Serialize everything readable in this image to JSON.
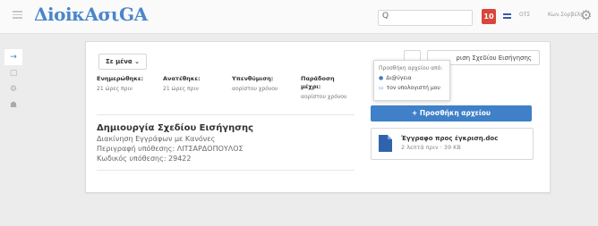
{
  "header": {
    "logo_text": "ΔiοiκΑσιGΑ",
    "search_placeholder": "",
    "notifications_count": "10",
    "ots_label": "ΟΤΣ",
    "user_label": "Κων.Σορβέλη"
  },
  "sidebar": {
    "items": [
      "→",
      "▢",
      "⚙",
      "☗"
    ]
  },
  "card": {
    "dropdown_label": "Σε μένα ⌄",
    "meta": [
      {
        "label": "Ενημερώθηκε:",
        "value": "21 ώρες πριν"
      },
      {
        "label": "Ανατέθηκε:",
        "value": "21 ώρες πριν"
      },
      {
        "label": "Υπενθύμιση:",
        "value": "αορίστου χρόνου"
      },
      {
        "label": "Παράδοση μέχρι:",
        "value": "αορίστου χρόνου"
      }
    ],
    "task_title": "Δημιουργία Σχεδίου Εισήγησης",
    "task_lines": [
      "Διακίνηση Εγγράφων με Κανόνες",
      "Περιγραφή υπόθεσης: ΛΙΤΣΑΡΔΟΠΟΥΛΟΣ",
      "Κωδικός υπόθεσης: 29422"
    ],
    "right_button_label": "ριση Σχεδίου Εισήγησης",
    "popup": {
      "header": "Προσθήκη αρχείου από:",
      "items": [
        {
          "icon": "cloud-icon",
          "label": "Δι@ύγεια"
        },
        {
          "icon": "computer-icon",
          "label": "τον υπολογιστή μου"
        }
      ]
    },
    "add_file_label": "+ Προσθήκη αρχείου",
    "file": {
      "name": "Έγγραφο προς έγκριση.doc",
      "meta": "2 λεπτά πριν · 39 KB"
    }
  },
  "colors": {
    "accent": "#3f80c8",
    "badge": "#d9463b"
  }
}
